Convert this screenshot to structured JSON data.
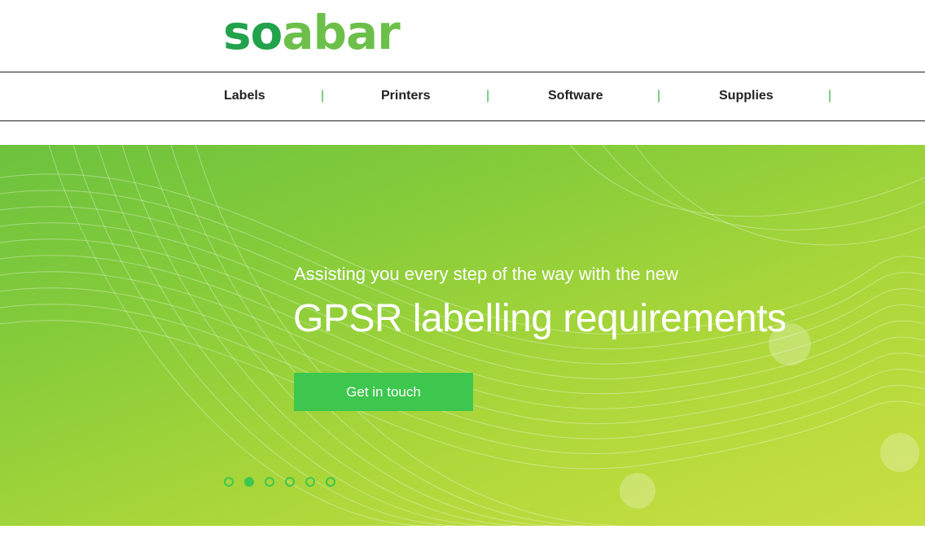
{
  "brand": {
    "logo_dark": "so",
    "logo_light": "abar"
  },
  "nav": {
    "items": [
      {
        "label": "Labels"
      },
      {
        "label": "Printers"
      },
      {
        "label": "Software"
      },
      {
        "label": "Supplies"
      }
    ],
    "separator": "|"
  },
  "hero": {
    "subtitle": "Assisting you every step of the way with the new",
    "title": "GPSR labelling requirements",
    "cta_label": "Get in touch",
    "slide_count": 6,
    "active_slide": 2
  },
  "colors": {
    "brand_green": "#22a24b",
    "brand_light_green": "#6cc04a",
    "cta_green": "#3ec74e"
  }
}
